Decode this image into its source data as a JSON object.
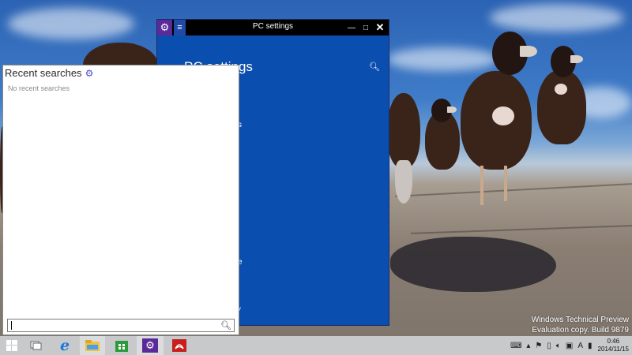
{
  "desktop": {
    "watermark_line1": "Windows Technical Preview",
    "watermark_line2": "Evaluation copy. Build 9879"
  },
  "pc_settings_window": {
    "title": "PC settings",
    "heading": "PC settings",
    "menu_glyph": "≡",
    "app_icon": "gear-icon",
    "controls": {
      "minimize": "—",
      "maximize": "□",
      "close": "✕"
    },
    "text_fragments": [
      "s",
      "e",
      "ery"
    ]
  },
  "recent_searches": {
    "title": "Recent searches",
    "empty_message": "No recent searches",
    "search_value": "",
    "search_placeholder": ""
  },
  "taskbar": {
    "items": [
      "start",
      "task-view",
      "internet-explorer",
      "file-explorer",
      "store",
      "pc-settings",
      "adobe-reader"
    ],
    "clock_time": "0:46",
    "clock_date": "2014/11/15",
    "input_indicator": "A"
  },
  "colors": {
    "pc_settings_bg": "#0a4fb0",
    "titlebar_bg": "#000000",
    "app_icon_bg": "#5b2a9a",
    "taskbar_bg": "#cdd0d4"
  }
}
